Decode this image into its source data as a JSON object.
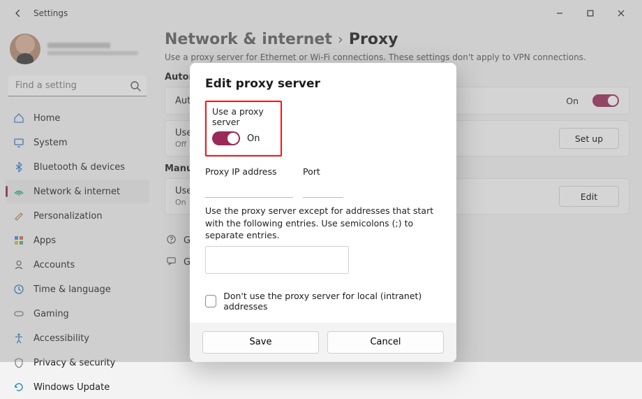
{
  "app": {
    "title": "Settings"
  },
  "window_controls": {
    "minimize": "minimize",
    "maximize": "maximize",
    "close": "close"
  },
  "sidebar": {
    "search_placeholder": "Find a setting",
    "items": [
      {
        "label": "Home",
        "icon": "home-icon"
      },
      {
        "label": "System",
        "icon": "system-icon"
      },
      {
        "label": "Bluetooth & devices",
        "icon": "bluetooth-icon"
      },
      {
        "label": "Network & internet",
        "icon": "network-icon",
        "selected": true
      },
      {
        "label": "Personalization",
        "icon": "personalization-icon"
      },
      {
        "label": "Apps",
        "icon": "apps-icon"
      },
      {
        "label": "Accounts",
        "icon": "accounts-icon"
      },
      {
        "label": "Time & language",
        "icon": "time-language-icon"
      },
      {
        "label": "Gaming",
        "icon": "gaming-icon"
      },
      {
        "label": "Accessibility",
        "icon": "accessibility-icon"
      },
      {
        "label": "Privacy & security",
        "icon": "privacy-icon"
      },
      {
        "label": "Windows Update",
        "icon": "update-icon"
      }
    ]
  },
  "breadcrumb": {
    "parent": "Network & internet",
    "sep": "›",
    "current": "Proxy"
  },
  "subtitle": "Use a proxy server for Ethernet or Wi-Fi connections. These settings don't apply to VPN connections.",
  "sections": {
    "auto": {
      "heading": "Automatic proxy setup",
      "card1": {
        "title": "Automatically detect settings",
        "toggle_state": "On"
      },
      "card2": {
        "title": "Use setup script",
        "state": "Off",
        "button": "Set up"
      }
    },
    "manual": {
      "heading": "Manual proxy setup",
      "card": {
        "title": "Use a proxy server",
        "state": "On",
        "button": "Edit"
      }
    }
  },
  "help": {
    "item1": "Get help",
    "item2": "Give feedback"
  },
  "modal": {
    "title": "Edit proxy server",
    "use_label": "Use a proxy server",
    "toggle_state": "On",
    "ip_label": "Proxy IP address",
    "ip_value": "",
    "port_label": "Port",
    "port_value": "",
    "hint": "Use the proxy server except for addresses that start with the following entries. Use semicolons (;) to separate entries.",
    "exclusions_value": "",
    "intranet_label": "Don't use the proxy server for local (intranet) addresses",
    "save": "Save",
    "cancel": "Cancel"
  }
}
